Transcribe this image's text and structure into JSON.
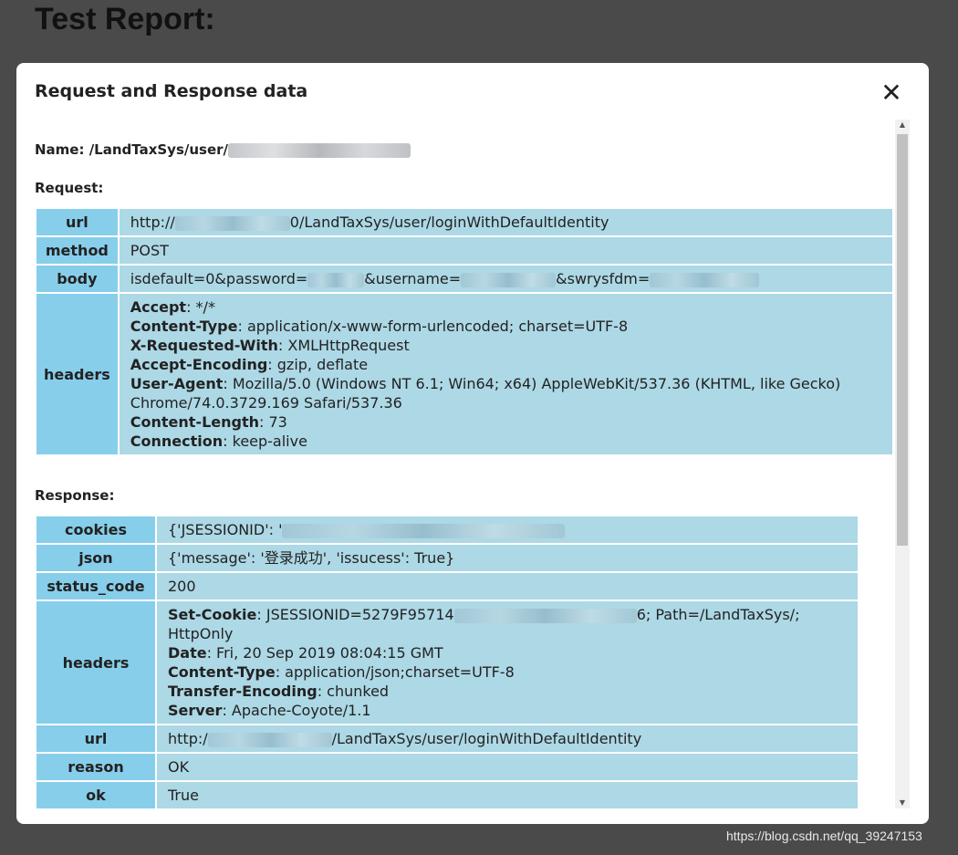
{
  "page": {
    "title": "Test Report:"
  },
  "modal": {
    "title": "Request and Response data",
    "close_icon": "close-icon",
    "name_label": "Name: /LandTaxSys/user/",
    "request_label": "Request:",
    "response_label": "Response:"
  },
  "request": {
    "url_key": "url",
    "url_prefix": "http://",
    "url_suffix": "0/LandTaxSys/user/loginWithDefaultIdentity",
    "method_key": "method",
    "method_value": "POST",
    "body_key": "body",
    "body_part1": "isdefault=0&password=",
    "body_part2": "&username=",
    "body_part3": "&swrysfdm=",
    "headers_key": "headers",
    "headers": [
      {
        "name": "Accept",
        "value": ": */*"
      },
      {
        "name": "Content-Type",
        "value": ": application/x-www-form-urlencoded; charset=UTF-8"
      },
      {
        "name": "X-Requested-With",
        "value": ": XMLHttpRequest"
      },
      {
        "name": "Accept-Encoding",
        "value": ": gzip, deflate"
      },
      {
        "name": "User-Agent",
        "value": ": Mozilla/5.0 (Windows NT 6.1; Win64; x64) AppleWebKit/537.36 (KHTML, like Gecko) Chrome/74.0.3729.169 Safari/537.36"
      },
      {
        "name": "Content-Length",
        "value": ": 73"
      },
      {
        "name": "Connection",
        "value": ": keep-alive"
      }
    ]
  },
  "response": {
    "cookies_key": "cookies",
    "cookies_prefix": "{'JSESSIONID': '",
    "json_key": "json",
    "json_value": "{'message': '登录成功', 'issucess': True}",
    "status_key": "status_code",
    "status_value": "200",
    "headers_key": "headers",
    "set_cookie_name": "Set-Cookie",
    "set_cookie_prefix": ": JSESSIONID=5279F95714",
    "set_cookie_suffix": "6; Path=/LandTaxSys/; HttpOnly",
    "headers": [
      {
        "name": "Date",
        "value": ": Fri, 20 Sep 2019 08:04:15 GMT"
      },
      {
        "name": "Content-Type",
        "value": ": application/json;charset=UTF-8"
      },
      {
        "name": "Transfer-Encoding",
        "value": ": chunked"
      },
      {
        "name": "Server",
        "value": ": Apache-Coyote/1.1"
      }
    ],
    "url_key": "url",
    "url_prefix": "http:/",
    "url_suffix": "/LandTaxSys/user/loginWithDefaultIdentity",
    "reason_key": "reason",
    "reason_value": "OK",
    "ok_key": "ok",
    "ok_value": "True"
  },
  "watermark": "https://blog.csdn.net/qq_39247153"
}
